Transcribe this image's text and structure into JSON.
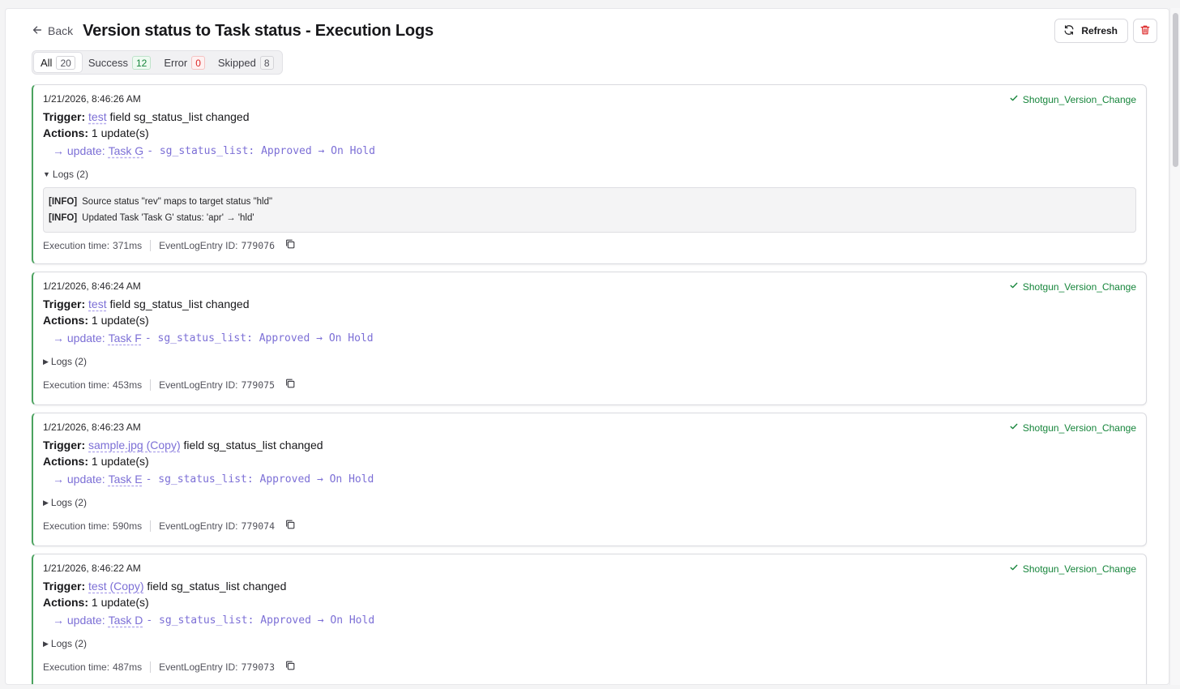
{
  "header": {
    "back_label": "Back",
    "title": "Version status to Task status - Execution Logs",
    "refresh_label": "Refresh"
  },
  "filters": [
    {
      "label": "All",
      "count": "20",
      "active": true,
      "tone": "default"
    },
    {
      "label": "Success",
      "count": "12",
      "active": false,
      "tone": "green"
    },
    {
      "label": "Error",
      "count": "0",
      "active": false,
      "tone": "red"
    },
    {
      "label": "Skipped",
      "count": "8",
      "active": false,
      "tone": "gray"
    }
  ],
  "labels": {
    "trigger": "Trigger:",
    "trigger_suffix": "field sg_status_list changed",
    "actions": "Actions:",
    "actions_value": "1 update(s)",
    "update_prefix": "→ update:",
    "exec_time_prefix": "Execution time:",
    "event_id_prefix": "EventLogEntry ID:"
  },
  "entries": [
    {
      "timestamp": "1/21/2026, 8:46:26 AM",
      "source": "Shotgun_Version_Change",
      "trigger_link": "test",
      "task_link": "Task G",
      "change": "- sg_status_list: Approved → On Hold",
      "logs_label": "Logs (2)",
      "logs_expanded": true,
      "logs": [
        {
          "level": "[INFO]",
          "message": "Source status \"rev\" maps to target status \"hld\""
        },
        {
          "level": "[INFO]",
          "message": "Updated Task 'Task G' status: 'apr' → 'hld'"
        }
      ],
      "exec_time": "371ms",
      "event_id": "779076"
    },
    {
      "timestamp": "1/21/2026, 8:46:24 AM",
      "source": "Shotgun_Version_Change",
      "trigger_link": "test",
      "task_link": "Task F",
      "change": "- sg_status_list: Approved → On Hold",
      "logs_label": "Logs (2)",
      "logs_expanded": false,
      "exec_time": "453ms",
      "event_id": "779075"
    },
    {
      "timestamp": "1/21/2026, 8:46:23 AM",
      "source": "Shotgun_Version_Change",
      "trigger_link": "sample.jpg (Copy)",
      "task_link": "Task E",
      "change": "- sg_status_list: Approved → On Hold",
      "logs_label": "Logs (2)",
      "logs_expanded": false,
      "exec_time": "590ms",
      "event_id": "779074"
    },
    {
      "timestamp": "1/21/2026, 8:46:22 AM",
      "source": "Shotgun_Version_Change",
      "trigger_link": "test (Copy)",
      "task_link": "Task D",
      "change": "- sg_status_list: Approved → On Hold",
      "logs_label": "Logs (2)",
      "logs_expanded": false,
      "exec_time": "487ms",
      "event_id": "779073"
    }
  ],
  "colors": {
    "success": "#16853b",
    "link": "#7c6fd6",
    "card_accent": "#4ba35f",
    "danger": "#dc2626"
  },
  "icons": {
    "back": "arrow-left-icon",
    "refresh": "refresh-icon",
    "delete": "trash-icon",
    "success": "check-icon",
    "copy": "copy-icon"
  }
}
